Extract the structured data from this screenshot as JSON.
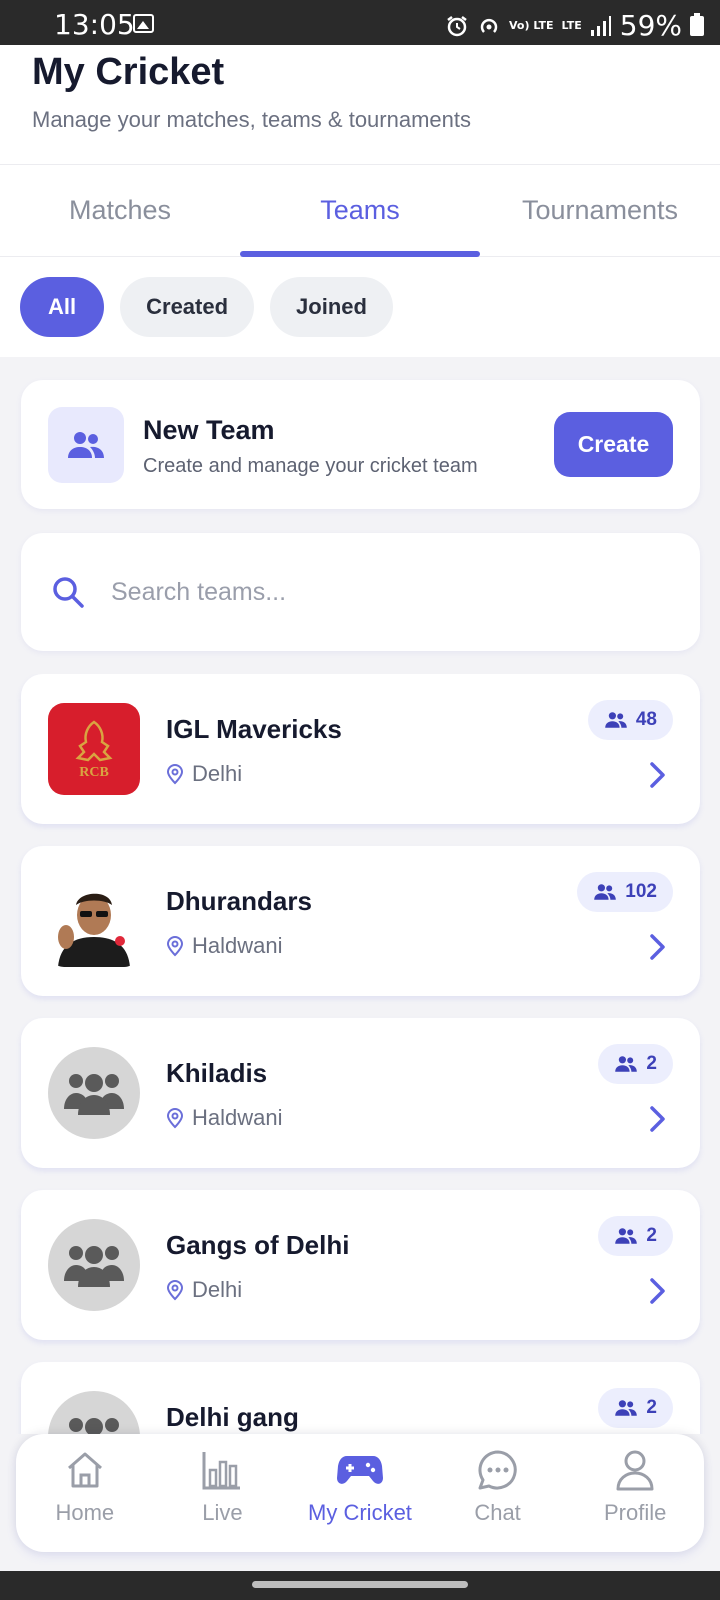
{
  "status_bar": {
    "time": "13:05",
    "battery": "59%",
    "volte_label": "Vo) LTE",
    "lte_label": "LTE"
  },
  "header": {
    "title": "My Cricket",
    "subtitle": "Manage your matches, teams & tournaments"
  },
  "tabs": [
    {
      "label": "Matches",
      "active": false
    },
    {
      "label": "Teams",
      "active": true
    },
    {
      "label": "Tournaments",
      "active": false
    }
  ],
  "filters": [
    {
      "label": "All",
      "active": true
    },
    {
      "label": "Created",
      "active": false
    },
    {
      "label": "Joined",
      "active": false
    }
  ],
  "new_team": {
    "title": "New Team",
    "description": "Create and manage your cricket team",
    "button": "Create"
  },
  "search": {
    "placeholder": "Search teams..."
  },
  "teams": [
    {
      "name": "IGL Mavericks",
      "location": "Delhi",
      "members": "48",
      "avatar": "rcb-logo"
    },
    {
      "name": "Dhurandars",
      "location": "Haldwani",
      "members": "102",
      "avatar": "person-photo"
    },
    {
      "name": "Khiladis",
      "location": "Haldwani",
      "members": "2",
      "avatar": "group-icon"
    },
    {
      "name": "Gangs of Delhi",
      "location": "Delhi",
      "members": "2",
      "avatar": "group-icon"
    },
    {
      "name": "Delhi gang",
      "location": "",
      "members": "2",
      "avatar": "group-icon"
    }
  ],
  "bottom_nav": [
    {
      "label": "Home",
      "icon": "home-icon",
      "active": false
    },
    {
      "label": "Live",
      "icon": "bar-chart-icon",
      "active": false
    },
    {
      "label": "My Cricket",
      "icon": "gamepad-icon",
      "active": true
    },
    {
      "label": "Chat",
      "icon": "chat-icon",
      "active": false
    },
    {
      "label": "Profile",
      "icon": "profile-icon",
      "active": false
    }
  ],
  "colors": {
    "accent": "#5b5fe0",
    "accent_soft": "#eceefd",
    "text_dark": "#161a2e",
    "muted": "#6b7080"
  }
}
